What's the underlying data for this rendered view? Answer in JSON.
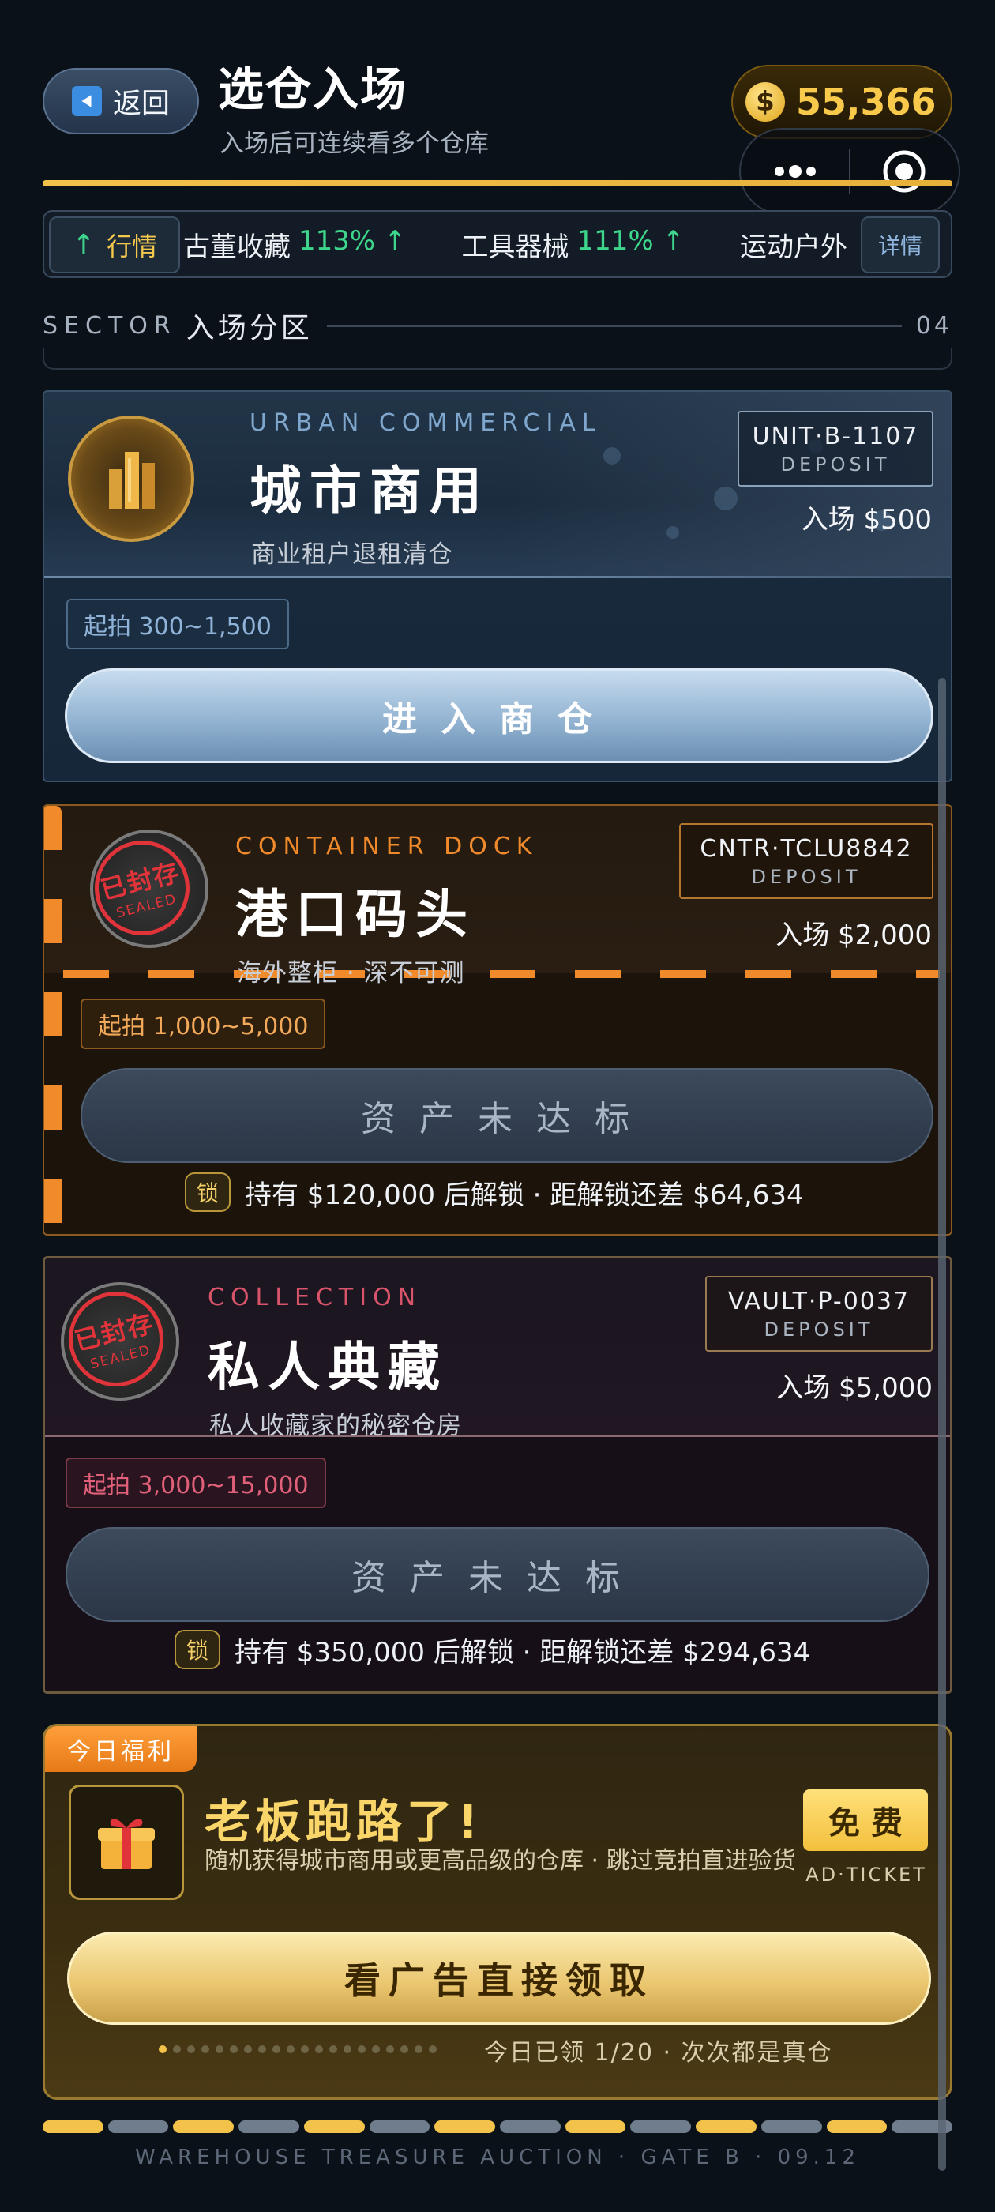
{
  "header": {
    "back_label": "返回",
    "title": "选仓入场",
    "subtitle": "入场后可连续看多个仓库",
    "coins": "55,366",
    "coin_symbol": "$",
    "progress": 1.0
  },
  "ticker": {
    "label": "行情",
    "label_arrow": "↑",
    "items": [
      {
        "name": "古董收藏",
        "value": "113% ↑"
      },
      {
        "name": "工具器械",
        "value": "111% ↑"
      },
      {
        "name": "运动户外",
        "value": ""
      }
    ],
    "detail_label": "详情"
  },
  "sector": {
    "en": "SECTOR",
    "cn": "入场分区",
    "count": "04"
  },
  "cards": [
    {
      "en": "URBAN COMMERCIAL",
      "cn": "城市商用",
      "desc": "商业租户退租清仓",
      "unit_code": "UNIT·B-1107",
      "unit_deposit": "DEPOSIT",
      "entry": "入场 $500",
      "range": "起拍 300~1,500",
      "button": "进入商仓",
      "accent": "#8fb3d9"
    },
    {
      "en": "CONTAINER DOCK",
      "cn": "港口码头",
      "desc": "海外整柜 · 深不可测",
      "unit_code": "CNTR·TCLU8842",
      "unit_deposit": "DEPOSIT",
      "entry": "入场 $2,000",
      "range": "起拍 1,000~5,000",
      "button": "资产未达标",
      "sealed_cn": "已封存",
      "sealed_en": "SEALED",
      "lock_badge": "锁",
      "lock_text": "持有 $120,000 后解锁 · 距解锁还差 $64,634",
      "accent": "#f08a2a"
    },
    {
      "en": "COLLECTION",
      "cn": "私人典藏",
      "desc": "私人收藏家的秘密仓房",
      "unit_code": "VAULT·P-0037",
      "unit_deposit": "DEPOSIT",
      "entry": "入场 $5,000",
      "range": "起拍 3,000~15,000",
      "button": "资产未达标",
      "sealed_cn": "已封存",
      "sealed_en": "SEALED",
      "lock_badge": "锁",
      "lock_text": "持有 $350,000 后解锁 · 距解锁还差 $294,634",
      "accent": "#d8546a"
    }
  ],
  "promo": {
    "tag": "今日福利",
    "title": "老板跑路了!",
    "desc": "随机获得城市商用或更高品级的仓库 · 跳过竞拍直进验货",
    "free": "免费",
    "ad_ticket": "AD·TICKET",
    "button": "看广告直接领取",
    "claimed": 1,
    "limit": 20,
    "claim_text": "今日已领 1/20 · 次次都是真仓"
  },
  "footer": "WAREHOUSE TREASURE AUCTION · GATE B · 09.12"
}
